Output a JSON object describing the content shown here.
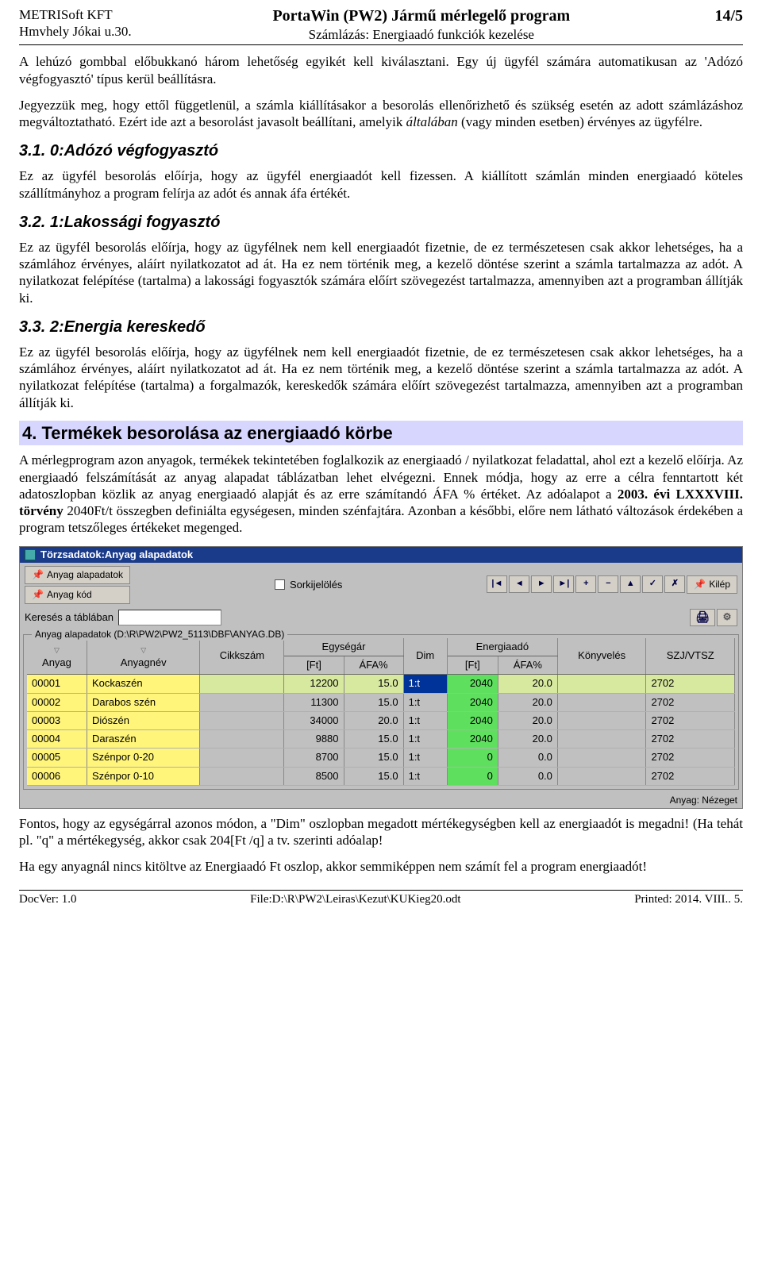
{
  "header": {
    "company": "METRISoft KFT",
    "address": "Hmvhely Jókai u.30.",
    "appTitle": "PortaWin (PW2) Jármű mérlegelő program",
    "subTitle": "Számlázás: Energiaadó funkciók kezelése",
    "pageNum": "14/5"
  },
  "body": {
    "p1": "A lehúzó gombbal előbukkanó három lehetőség egyikét kell kiválasztani. Egy új ügyfél számára automatikusan az 'Adózó végfogyasztó' típus kerül beállításra.",
    "p2a": "Jegyezzük meg, hogy ettől függetlenül, a számla kiállításakor a besorolás ellenőrizhető és szükség esetén az adott számlázáshoz megváltoztatható. Ezért ide azt a besorolást javasolt beállítani, amelyik ",
    "p2i": "általában",
    "p2b": " (vagy minden esetben) érvényes az ügyfélre.",
    "h31": "3.1. 0:Adózó végfogyasztó",
    "p3": "Ez az ügyfél besorolás előírja, hogy az ügyfél energiaadót kell fizessen.  A kiállított számlán minden energiaadó köteles szállítmányhoz a program felírja az adót és annak áfa értékét.",
    "h32": "3.2. 1:Lakossági fogyasztó",
    "p4": "Ez az ügyfél besorolás előírja, hogy az ügyfélnek nem kell energiaadót fizetnie, de ez természetesen csak akkor lehetséges, ha a számlához érvényes, aláírt nyilatkozatot ad át. Ha ez nem történik meg, a kezelő döntése szerint a számla tartalmazza az adót. A nyilatkozat felépítése (tartalma) a lakossági fogyasztók számára előírt szövegezést tartalmazza, amennyiben azt a programban állítják ki.",
    "h33": "3.3. 2:Energia kereskedő",
    "p5": "Ez az ügyfél besorolás előírja, hogy az ügyfélnek nem kell energiaadót fizetnie, de ez természetesen csak akkor lehetséges, ha a számlához érvényes, aláírt nyilatkozatot ad át. Ha ez nem történik meg, a kezelő döntése szerint a számla tartalmazza az adót.  A nyilatkozat felépítése (tartalma) a forgalmazók, kereskedők számára előírt szövegezést tartalmazza, amennyiben azt a programban állítják ki.",
    "h2": "4. Termékek besorolása az energiaadó körbe",
    "p6a": "A mérlegprogram azon anyagok, termékek tekintetében foglalkozik az energiaadó / nyilatkozat feladattal, ahol ezt a kezelő előírja. Az energiaadó felszámítását az anyag alapadat táblázatban lehet elvégezni. Ennek módja, hogy az erre a célra fenntartott két adatoszlopban közlik az anyag energiaadó alapját és az erre számítandó ÁFA % értéket.  Az adóalapot a ",
    "p6b": "2003. évi LXXXVIII. törvény",
    "p6c": " 2040Ft/t összegben definiálta egységesen, minden szénfajtára. Azonban a későbbi, előre nem látható változások érdekében a program tetszőleges értékeket megenged.",
    "p7": "Fontos, hogy az egységárral azonos módon, a \"Dim\" oszlopban megadott mértékegységben kell az energiaadót is megadni! (Ha tehát pl. \"q\" a mértékegység, akkor csak 204[Ft /q] a tv. szerinti adóalap!",
    "p8": "Ha egy anyagnál nincs kitöltve az Energiaadó Ft oszlop, akkor semmiképpen nem számít fel a program energiaadót!"
  },
  "app": {
    "title": "Törzsadatok:Anyag alapadatok",
    "btnAlap": "Anyag alapadatok",
    "btnKod": "Anyag kód",
    "sorkijel": "Sorkijelölés",
    "kilep": "Kilép",
    "kereses": "Keresés a táblában",
    "grouplabel": "Anyag alapadatok (D:\\R\\PW2\\PW2_5113\\DBF\\ANYAG.DB)",
    "cols": {
      "anyag": "Anyag",
      "anyagnev": "Anyagnév",
      "cikkszam": "Cikkszám",
      "egysegar": "Egységár",
      "ft": "[Ft]",
      "afa": "ÁFA%",
      "dim": "Dim",
      "energia": "Energiaadó",
      "konyv": "Könyvelés",
      "szj": "SZJ/VTSZ"
    },
    "rows": [
      {
        "a": "00001",
        "n": "Kockaszén",
        "c": "",
        "ft": "12200",
        "afa": "15.0",
        "dim": "1:t",
        "eft": "2040",
        "eafa": "20.0",
        "k": "",
        "szj": "2702"
      },
      {
        "a": "00002",
        "n": "Darabos szén",
        "c": "",
        "ft": "11300",
        "afa": "15.0",
        "dim": "1:t",
        "eft": "2040",
        "eafa": "20.0",
        "k": "",
        "szj": "2702"
      },
      {
        "a": "00003",
        "n": "Diószén",
        "c": "",
        "ft": "34000",
        "afa": "20.0",
        "dim": "1:t",
        "eft": "2040",
        "eafa": "20.0",
        "k": "",
        "szj": "2702"
      },
      {
        "a": "00004",
        "n": "Daraszén",
        "c": "",
        "ft": "9880",
        "afa": "15.0",
        "dim": "1:t",
        "eft": "2040",
        "eafa": "20.0",
        "k": "",
        "szj": "2702"
      },
      {
        "a": "00005",
        "n": "Szénpor 0-20",
        "c": "",
        "ft": "8700",
        "afa": "15.0",
        "dim": "1:t",
        "eft": "0",
        "eafa": "0.0",
        "k": "",
        "szj": "2702"
      },
      {
        "a": "00006",
        "n": "Szénpor 0-10",
        "c": "",
        "ft": "8500",
        "afa": "15.0",
        "dim": "1:t",
        "eft": "0",
        "eafa": "0.0",
        "k": "",
        "szj": "2702"
      }
    ],
    "footer": "Anyag: Nézeget"
  },
  "footer": {
    "doc": "DocVer: 1.0",
    "file": "File:D:\\R\\PW2\\Leiras\\Kezut\\KUKieg20.odt",
    "printed": "Printed: 2014. VIII.. 5."
  }
}
